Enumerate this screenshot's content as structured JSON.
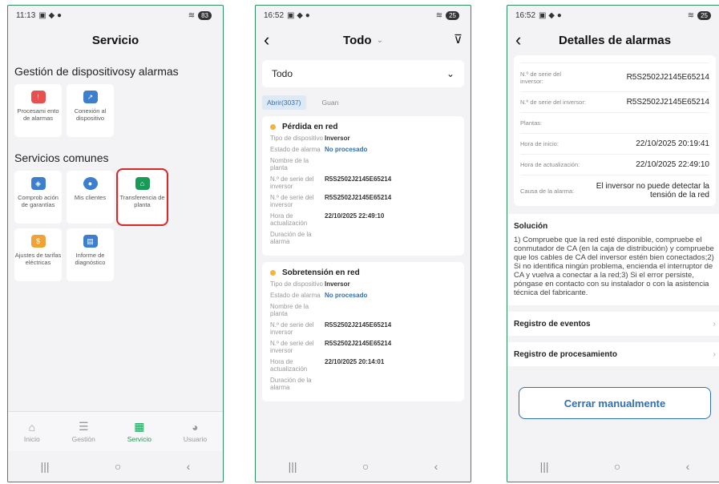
{
  "p1": {
    "status": {
      "time": "11:13",
      "battery": "83"
    },
    "title": "Servicio",
    "section1": "Gestión de dispositivosy alarmas",
    "tiles1": [
      {
        "label": "Procesami ento de alarmas"
      },
      {
        "label": "Conexión al dispositivo"
      }
    ],
    "section2": "Servicios comunes",
    "tiles2": [
      {
        "label": "Comprob ación de garantías"
      },
      {
        "label": "Mis clientes"
      },
      {
        "label": "Transferencia de planta"
      },
      {
        "label": "Ajustes de tarifas eléctricas"
      },
      {
        "label": "Informe de diagnóstico"
      }
    ],
    "tabs": [
      {
        "label": "Inicio"
      },
      {
        "label": "Gestión"
      },
      {
        "label": "Servicio"
      },
      {
        "label": "Usuario"
      }
    ]
  },
  "p2": {
    "status": {
      "time": "16:52",
      "battery": "25"
    },
    "title": "Todo",
    "dropdown": "Todo",
    "chips": [
      "Abrir(3037)",
      "Guan"
    ],
    "cards": [
      {
        "title": "Pérdida en red",
        "rows": [
          {
            "k": "Tipo de dispositivo",
            "v": "Inversor"
          },
          {
            "k": "Estado de alarma",
            "v": "No procesado"
          },
          {
            "k": "Nombre de la planta",
            "v": ""
          },
          {
            "k": "N.º de serie del inversor",
            "v": "R5S2502J2145E65214"
          },
          {
            "k": "N.º de serie del inversor",
            "v": "R5S2502J2145E65214"
          },
          {
            "k": "Hora de actualización",
            "v": "22/10/2025 22:49:10"
          },
          {
            "k": "Duración de la alarma",
            "v": ""
          }
        ]
      },
      {
        "title": "Sobretensión en red",
        "rows": [
          {
            "k": "Tipo de dispositivo",
            "v": "Inversor"
          },
          {
            "k": "Estado de alarma",
            "v": "No procesado"
          },
          {
            "k": "Nombre de la planta",
            "v": ""
          },
          {
            "k": "N.º de serie del inversor",
            "v": "R5S2502J2145E65214"
          },
          {
            "k": "N.º de serie del inversor",
            "v": "R5S2502J2145E65214"
          },
          {
            "k": "Hora de actualización",
            "v": "22/10/2025 20:14:01"
          },
          {
            "k": "Duración de la alarma",
            "v": ""
          }
        ]
      }
    ]
  },
  "p3": {
    "status": {
      "time": "16:52",
      "battery": "25"
    },
    "title": "Detalles de alarmas",
    "rows": [
      {
        "k": "N.º de serie del inversor:",
        "v": "R5S2502J2145E65214"
      },
      {
        "k": "N.º de serie del inversor:",
        "v": "R5S2502J2145E65214"
      },
      {
        "k": "Plantas:",
        "v": ""
      },
      {
        "k": "Hora de inicio:",
        "v": "22/10/2025 20:19:41"
      },
      {
        "k": "Hora de actualización:",
        "v": "22/10/2025 22:49:10"
      },
      {
        "k": "Causa de la alarma:",
        "v": "El inversor no puede detectar la tensión de la red"
      }
    ],
    "solution_title": "Solución",
    "solution_text": "1) Compruebe que la red esté disponible, compruebe el conmutador de CA (en la caja de distribución) y compruebe que los cables de CA del inversor estén bien conectados;2) Si no identifica ningún problema, encienda el interruptor de CA y vuelva a conectar a la red;3) Si el error persiste, póngase en contacto con su instalador o con la asistencia técnica del fabricante.",
    "links": [
      "Registro de eventos",
      "Registro de procesamiento"
    ],
    "close_button": "Cerrar manualmente"
  },
  "colors": {
    "accent": "#1a9a57",
    "blue": "#2f6fb5",
    "highlight": "#d42a2a",
    "warn": "#f3b43f"
  }
}
